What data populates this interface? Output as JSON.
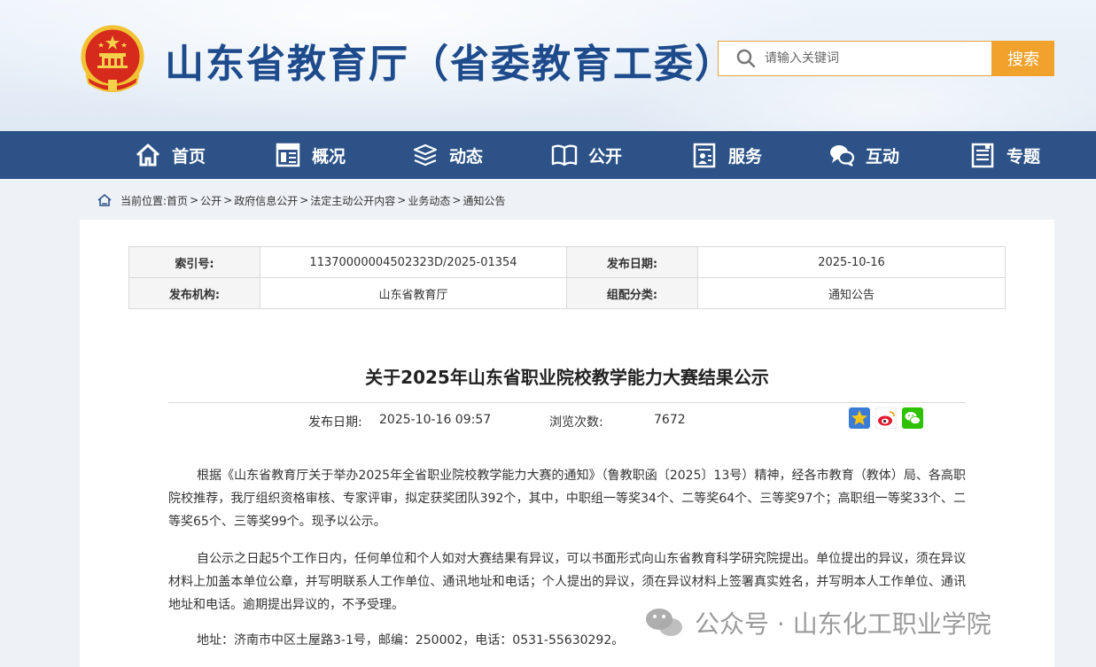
{
  "header": {
    "site_title": "山东省教育厅（省委教育工委）",
    "search": {
      "placeholder": "请输入关键词",
      "button_label": "搜索"
    }
  },
  "nav": {
    "items": [
      {
        "label": "首页",
        "icon": "home-icon"
      },
      {
        "label": "概况",
        "icon": "overview-icon"
      },
      {
        "label": "动态",
        "icon": "news-stack-icon"
      },
      {
        "label": "公开",
        "icon": "open-book-icon"
      },
      {
        "label": "服务",
        "icon": "service-icon"
      },
      {
        "label": "互动",
        "icon": "chat-bubbles-icon"
      },
      {
        "label": "专题",
        "icon": "topic-icon"
      }
    ]
  },
  "breadcrumb": {
    "prefix": "当前位置:",
    "items": [
      "首页",
      "公开",
      "政府信息公开",
      "法定主动公开内容",
      "业务动态",
      "通知公告"
    ],
    "separator": ">"
  },
  "meta": {
    "index_label": "索引号:",
    "index_value": "11370000004502323D/2025-01354",
    "date_label": "发布日期:",
    "date_value": "2025-10-16",
    "org_label": "发布机构:",
    "org_value": "山东省教育厅",
    "category_label": "组配分类:",
    "category_value": "通知公告"
  },
  "article": {
    "title": "关于2025年山东省职业院校教学能力大赛结果公示",
    "publish_label": "发布日期:",
    "publish_value": "2025-10-16 09:57",
    "views_label": "浏览次数:",
    "views_value": "7672",
    "share_icons": [
      "qzone-star-icon",
      "weibo-icon",
      "wechat-icon"
    ],
    "paragraphs": [
      "根据《山东省教育厅关于举办2025年全省职业院校教学能力大赛的通知》（鲁教职函〔2025〕13号）精神，经各市教育（教体）局、各高职院校推荐，我厅组织资格审核、专家评审，拟定获奖团队392个，其中，中职组一等奖34个、二等奖64个、三等奖97个；高职组一等奖33个、二等奖65个、三等奖99个。现予以公示。",
      "自公示之日起5个工作日内，任何单位和个人如对大赛结果有异议，可以书面形式向山东省教育科学研究院提出。单位提出的异议，须在异议材料上加盖本单位公章，并写明联系人工作单位、通讯地址和电话；个人提出的异议，须在异议材料上签署真实姓名，并写明本人工作单位、通讯地址和电话。逾期提出异议的，不予受理。",
      "地址：济南市中区土屋路3-1号，邮编：250002，电话：0531-55630292。"
    ]
  },
  "watermark": {
    "text": "公众号 · 山东化工职业学院"
  }
}
